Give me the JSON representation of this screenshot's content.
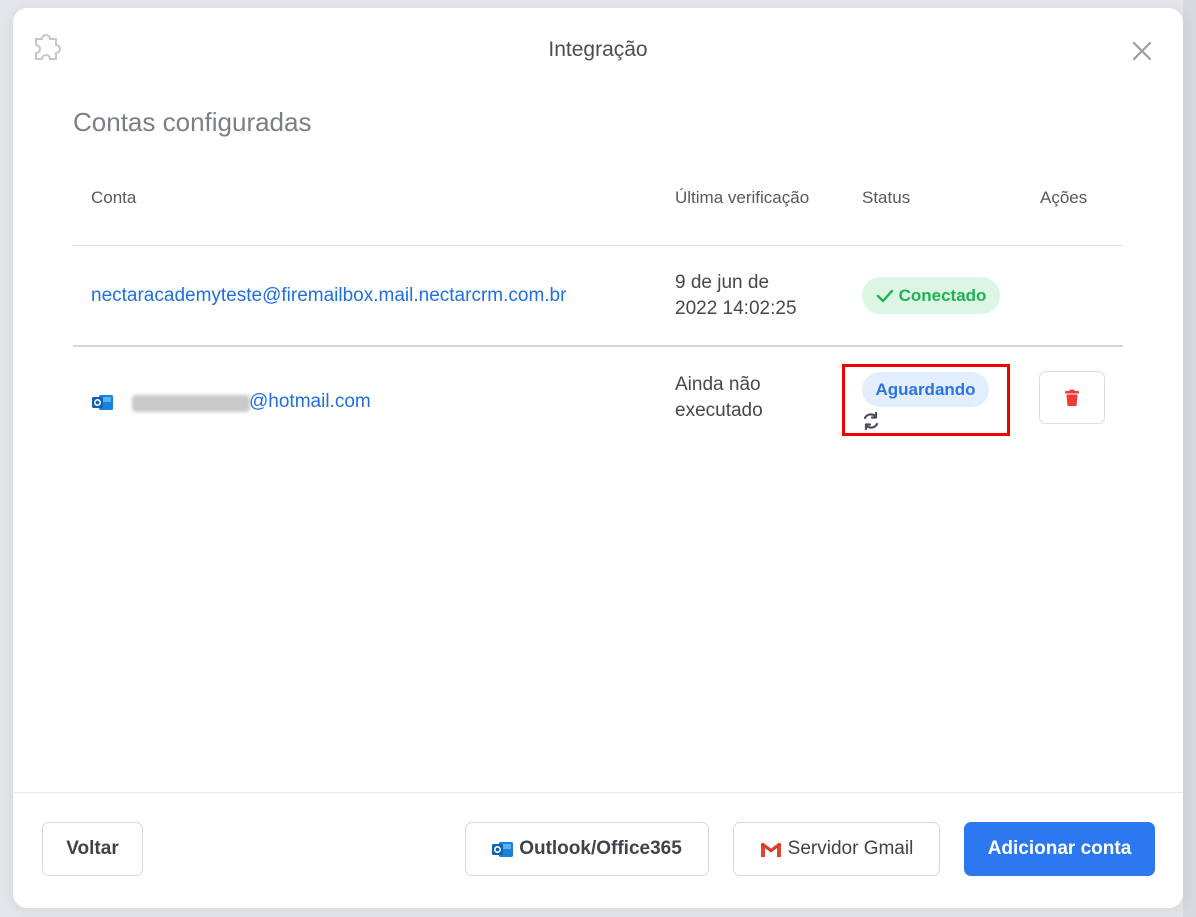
{
  "modal": {
    "title": "Integração",
    "icon": "puzzle-icon",
    "close_icon": "close-icon"
  },
  "section": {
    "title": "Contas configuradas"
  },
  "table": {
    "headers": {
      "account": "Conta",
      "last_check": "Última verificação",
      "status": "Status",
      "actions": "Ações"
    },
    "rows": [
      {
        "email": "nectaracademyteste@firemailbox.mail.nectarcrm.com.br",
        "last_check_line1": "9 de jun de",
        "last_check_line2": "2022 14:02:25",
        "status": "Conectado",
        "status_color": "#1db352"
      },
      {
        "provider_icon": "outlook-icon",
        "email_visible_part": "@hotmail.com",
        "last_check_line1": "Ainda não",
        "last_check_line2": "executado",
        "status": "Aguardando",
        "status_color": "#2c73e2",
        "refresh_icon": "refresh-icon",
        "delete_icon": "trash-icon"
      }
    ]
  },
  "footer": {
    "back_label": "Voltar",
    "outlook_label": "Outlook/Office365",
    "gmail_label": "Servidor Gmail",
    "add_label": "Adicionar conta",
    "primary_color": "#2b78f0"
  }
}
